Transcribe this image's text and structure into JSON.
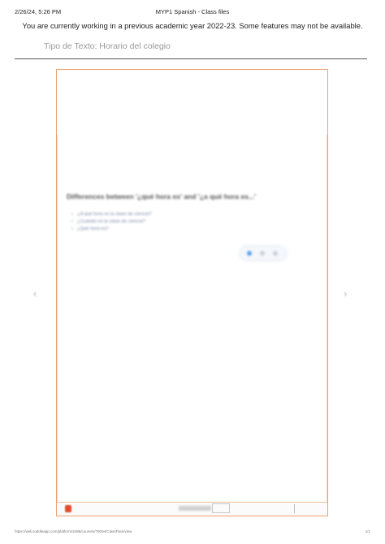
{
  "print_header": {
    "date": "2/26/24, 5:26 PM",
    "title": "MYP1 Spanish - Class files"
  },
  "notice": "You are currently working in a previous academic year 2022-23. Some features may not be available.",
  "text_type": "Tipo de Texto: Horario del colegio",
  "document": {
    "heading": "Differences between '¿qué hora es' and '¿a qué hora es...'",
    "questions": [
      "¿A qué hora es la clase de ciencia?",
      "¿Cuándo es la clase de ciencia?",
      "¿Qué hora es?"
    ]
  },
  "nav": {
    "prev": "‹",
    "next": "›"
  },
  "footer": {
    "url": "https://web.toddleapp.com/platform/4488/courses/79094/ClassFiles/view",
    "page": "1/1"
  }
}
